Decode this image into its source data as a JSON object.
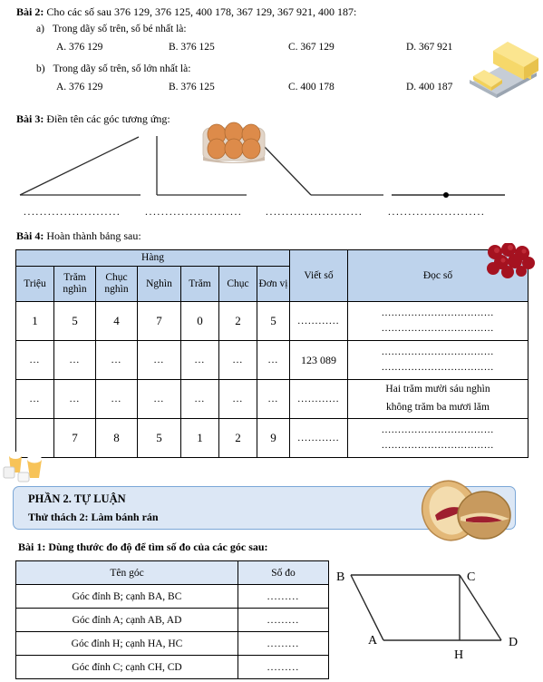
{
  "bai2": {
    "heading": "Bài 2:",
    "prompt": "Cho các số sau 376 129, 376 125, 400 178, 367 129, 367 921, 400 187:",
    "part_a": {
      "label": "a)",
      "text": "Trong dãy số trên, số bé nhất là:",
      "options": [
        "A. 376 129",
        "B. 376 125",
        "C. 367 129",
        "D. 367 921"
      ]
    },
    "part_b": {
      "label": "b)",
      "text": "Trong dãy số trên, số lớn nhất là:",
      "options": [
        "A. 376 129",
        "B. 376 125",
        "C. 400 178",
        "D. 400 187"
      ]
    }
  },
  "bai3": {
    "heading": "Bài 3:",
    "prompt": "Điền tên các góc tương ứng:",
    "angles": [
      "acute-angle",
      "right-angle",
      "obtuse-angle",
      "straight-angle"
    ],
    "answer_blanks": [
      "........................",
      "........................",
      "........................",
      "........................"
    ]
  },
  "bai4": {
    "heading": "Bài 4:",
    "prompt": "Hoàn thành bảng sau:",
    "table": {
      "group_header": "Hàng",
      "place_headers": [
        "Triệu",
        "Trăm nghìn",
        "Chục nghìn",
        "Nghìn",
        "Trăm",
        "Chục",
        "Đơn vị"
      ],
      "write_header": "Viết số",
      "read_header": "Đọc số",
      "rows": [
        {
          "digits": [
            "1",
            "5",
            "4",
            "7",
            "0",
            "2",
            "5"
          ],
          "write": "............",
          "read_lines": [
            "..................................",
            ".................................."
          ]
        },
        {
          "digits": [
            "...",
            "...",
            "...",
            "...",
            "...",
            "...",
            "..."
          ],
          "write": "123 089",
          "read_lines": [
            "..................................",
            ".................................."
          ]
        },
        {
          "digits": [
            "...",
            "...",
            "...",
            "...",
            "...",
            "...",
            "..."
          ],
          "write": "............",
          "read_lines": [
            "Hai trăm mười sáu nghìn",
            "không trăm ba mươi lăm"
          ]
        },
        {
          "digits": [
            "",
            "7",
            "8",
            "5",
            "1",
            "2",
            "9"
          ],
          "write": "............",
          "read_lines": [
            "..................................",
            ".................................."
          ]
        }
      ]
    }
  },
  "phan2": {
    "title": "PHẦN 2. TỰ LUẬN",
    "subtitle": "Thử thách 2: Làm bánh rán"
  },
  "bai1": {
    "heading": "Bài 1:",
    "prompt": "Dùng thước đo độ để tìm số đo của các góc sau:",
    "table": {
      "headers": [
        "Tên góc",
        "Số đo"
      ],
      "rows": [
        {
          "name": "Góc đỉnh B; cạnh BA, BC",
          "measure": "........."
        },
        {
          "name": "Góc đỉnh A; cạnh AB, AD",
          "measure": "........."
        },
        {
          "name": "Góc đỉnh H; cạnh HA, HC",
          "measure": "........."
        },
        {
          "name": "Góc đỉnh C; cạnh CH, CD",
          "measure": "........."
        }
      ]
    },
    "figure": {
      "name": "parallelogram-abcd",
      "vertices": [
        "B",
        "C",
        "A",
        "H",
        "D"
      ]
    }
  },
  "colors": {
    "table_header_blue": "#bed3ec",
    "panel_blue": "#dce7f5",
    "panel_border": "#7ba7d7",
    "line": "#000000"
  },
  "decorations": [
    "butter-dish-image",
    "egg-carton-image",
    "cherries-image",
    "drinks-image",
    "pancake-image"
  ]
}
